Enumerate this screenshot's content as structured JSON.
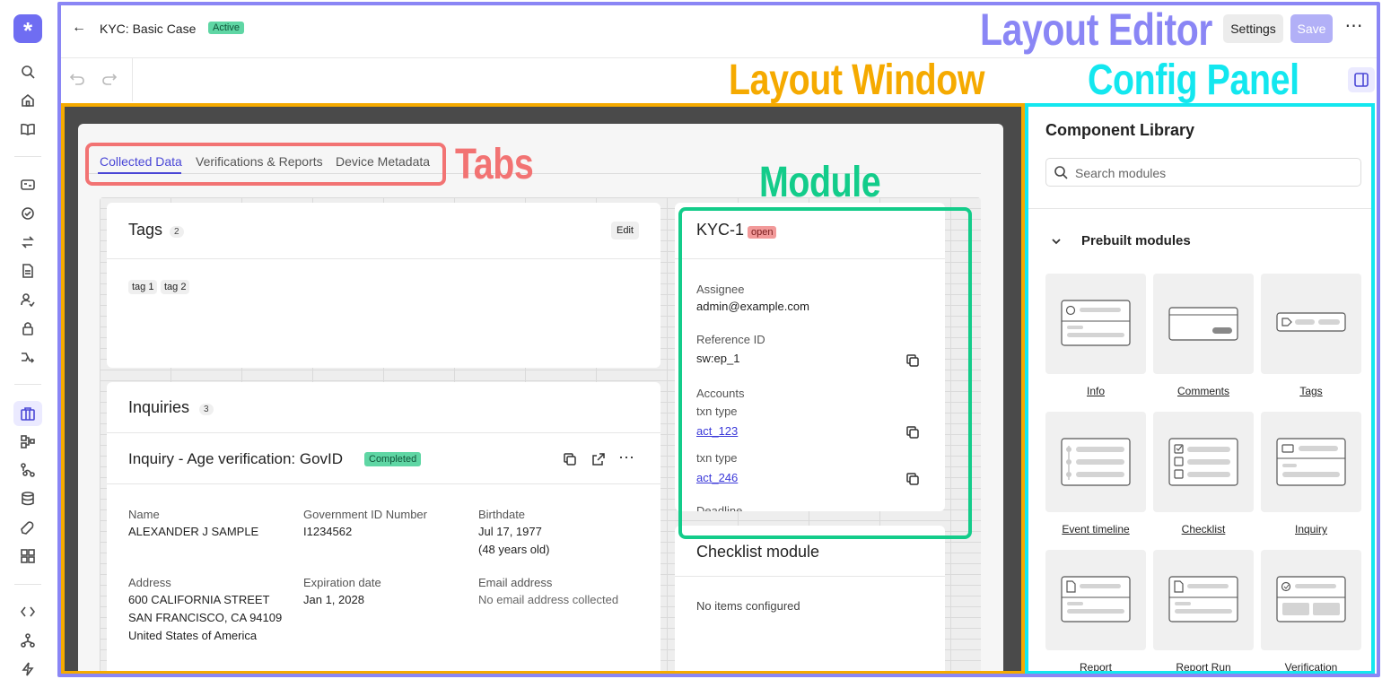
{
  "app": {
    "logo_glyph": "*"
  },
  "header": {
    "back_glyph": "←",
    "case_title": "KYC: Basic Case",
    "status": "Active",
    "settings_label": "Settings",
    "save_label": "Save",
    "more_glyph": "⋯"
  },
  "annotations": {
    "layout_editor": "Layout Editor",
    "layout_window": "Layout Window",
    "config_panel": "Config Panel",
    "tabs": "Tabs",
    "module": "Module"
  },
  "tabs": [
    "Collected Data",
    "Verifications & Reports",
    "Device Metadata"
  ],
  "tags_card": {
    "title": "Tags",
    "count": "2",
    "edit_label": "Edit",
    "tags": [
      "tag 1",
      "tag 2"
    ]
  },
  "inquiries_card": {
    "title": "Inquiries",
    "count": "3",
    "inquiry_title": "Inquiry - Age verification: GovID",
    "inquiry_status": "Completed",
    "fields": [
      {
        "label": "Name",
        "value": "ALEXANDER J SAMPLE"
      },
      {
        "label": "Government ID Number",
        "value": "I1234562"
      },
      {
        "label": "Birthdate",
        "value": "Jul 17, 1977"
      },
      {
        "label": "Address",
        "value": "600 CALIFORNIA STREET"
      },
      {
        "label": "Expiration date",
        "value": "Jan 1, 2028"
      },
      {
        "label": "Email address",
        "value": "No email address collected"
      }
    ],
    "birthdate_age": "(48 years old)",
    "address_line2": "SAN FRANCISCO, CA 94109",
    "address_line3": "United States of America"
  },
  "kyc_card": {
    "title": "KYC-1",
    "status": "open",
    "assignee_label": "Assignee",
    "assignee_value": "admin@example.com",
    "refid_label": "Reference ID",
    "refid_value": "sw:ep_1",
    "accounts_label": "Accounts",
    "accounts": [
      {
        "type": "txn type",
        "id": "act_123"
      },
      {
        "type": "txn type",
        "id": "act_246"
      }
    ],
    "deadline_label": "Deadline"
  },
  "checklist_card": {
    "title": "Checklist module",
    "empty_text": "No items configured"
  },
  "config": {
    "title": "Component Library",
    "search_placeholder": "Search modules",
    "section_title": "Prebuilt modules",
    "modules": [
      "Info",
      "Comments",
      "Tags",
      "Event timeline",
      "Checklist",
      "Inquiry",
      "Report",
      "Report Run",
      "Verification"
    ]
  },
  "colors": {
    "accent": "#4a47d6",
    "editor_outline": "#8a86f5",
    "window_outline": "#f5aa00",
    "config_outline": "#13e7ef",
    "tabs_outline": "#f27373",
    "module_outline": "#13cc8a"
  },
  "icons": {
    "nav": [
      "search-icon",
      "home-icon",
      "book-icon",
      "id-card-icon",
      "check-circle-icon",
      "transfer-icon",
      "document-icon",
      "user-check-icon",
      "lock-icon",
      "workflow-icon",
      "briefcase-icon",
      "flow-icon",
      "graph-icon",
      "database-icon",
      "wrench-icon",
      "grid-icon",
      "code-icon",
      "nodes-icon",
      "lightning-icon"
    ]
  }
}
